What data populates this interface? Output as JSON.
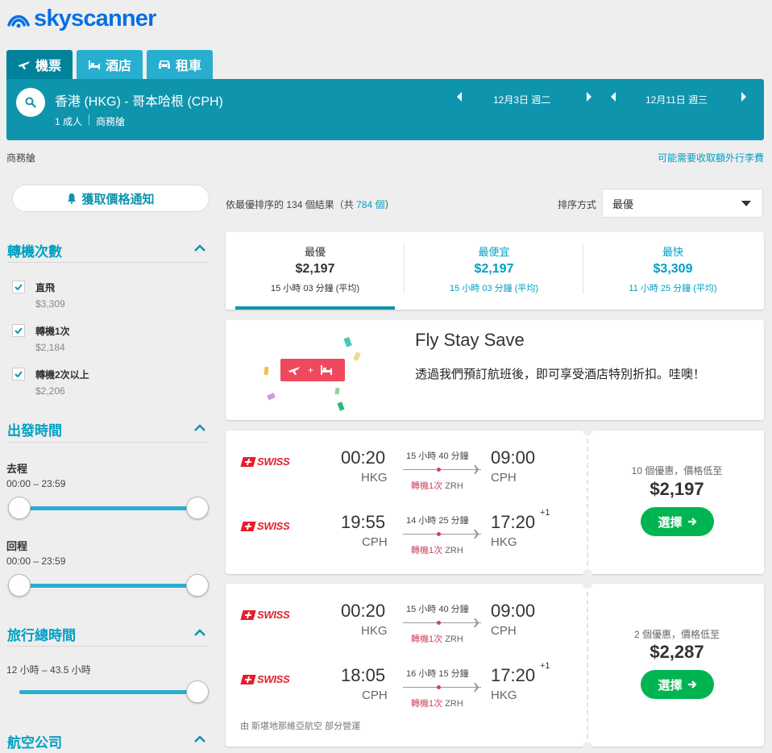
{
  "header": {
    "logo_text": "skyscanner",
    "tabs": [
      {
        "label": "機票",
        "icon": "plane-icon",
        "active": true
      },
      {
        "label": "酒店",
        "icon": "bed-icon",
        "active": false
      },
      {
        "label": "租車",
        "icon": "car-icon",
        "active": false
      }
    ]
  },
  "search": {
    "route": "香港 (HKG) - 哥本哈根 (CPH)",
    "passengers": "1 成人",
    "cabin": "商務艙",
    "outbound_date": "12月3日 週二",
    "return_date": "12月11日 週三"
  },
  "subheader": {
    "cabin_label": "商務艙",
    "baggage_link": "可能需要收取額外行李費"
  },
  "sidebar": {
    "price_alert": "獲取價格通知",
    "stops": {
      "title": "轉機次數",
      "options": [
        {
          "label": "直飛",
          "price": "$3,309",
          "checked": true
        },
        {
          "label": "轉機1次",
          "price": "$2,184",
          "checked": true
        },
        {
          "label": "轉機2次以上",
          "price": "$2,206",
          "checked": true
        }
      ]
    },
    "departure": {
      "title": "出發時間",
      "outbound_label": "去程",
      "outbound_range": "00:00 – 23:59",
      "return_label": "回程",
      "return_range": "00:00 – 23:59"
    },
    "duration": {
      "title": "旅行總時間",
      "range": "12 小時 – 43.5 小時"
    },
    "airlines": {
      "title": "航空公司"
    }
  },
  "results": {
    "count_prefix": "依最優排序的",
    "count": "134",
    "count_mid": "個結果（共",
    "total": "784 個",
    "count_suffix": "）",
    "sort_label": "排序方式",
    "sort_value": "最優"
  },
  "sort_tabs": [
    {
      "label": "最優",
      "price": "$2,197",
      "duration": "15 小時 03 分鐘 (平均)"
    },
    {
      "label": "最便宜",
      "price": "$2,197",
      "duration": "15 小時 03 分鐘 (平均)"
    },
    {
      "label": "最快",
      "price": "$3,309",
      "duration": "11 小時 25 分鐘 (平均)"
    }
  ],
  "promo": {
    "title": "Fly Stay Save",
    "text": "透過我們預訂航班後，即可享受酒店特別折扣。哇噢！"
  },
  "flights": [
    {
      "legs": [
        {
          "airline": "SWISS",
          "dep_time": "00:20",
          "dep_code": "HKG",
          "duration": "15 小時 40 分鐘",
          "stops": "轉機1次",
          "via": "ZRH",
          "arr_time": "09:00",
          "arr_code": "CPH",
          "plus": ""
        },
        {
          "airline": "SWISS",
          "dep_time": "19:55",
          "dep_code": "CPH",
          "duration": "14 小時 25 分鐘",
          "stops": "轉機1次",
          "via": "ZRH",
          "arr_time": "17:20",
          "arr_code": "HKG",
          "plus": "+1"
        }
      ],
      "deals": "10 個優惠，價格低至",
      "price": "$2,197",
      "select": "選擇",
      "operated": ""
    },
    {
      "legs": [
        {
          "airline": "SWISS",
          "dep_time": "00:20",
          "dep_code": "HKG",
          "duration": "15 小時 40 分鐘",
          "stops": "轉機1次",
          "via": "ZRH",
          "arr_time": "09:00",
          "arr_code": "CPH",
          "plus": ""
        },
        {
          "airline": "SWISS",
          "dep_time": "18:05",
          "dep_code": "CPH",
          "duration": "16 小時 15 分鐘",
          "stops": "轉機1次",
          "via": "ZRH",
          "arr_time": "17:20",
          "arr_code": "HKG",
          "plus": "+1"
        }
      ],
      "deals": "2 個優惠，價格低至",
      "price": "$2,287",
      "select": "選擇",
      "operated": "由 斯堪地那維亞航空 部分營運"
    }
  ],
  "colors": {
    "brand": "#0770e3",
    "header_bar": "#0f94ad",
    "accent": "#00a0c4",
    "select_button": "#00b551",
    "stops_red": "#d1435b",
    "swiss_red": "#e41e2b"
  }
}
